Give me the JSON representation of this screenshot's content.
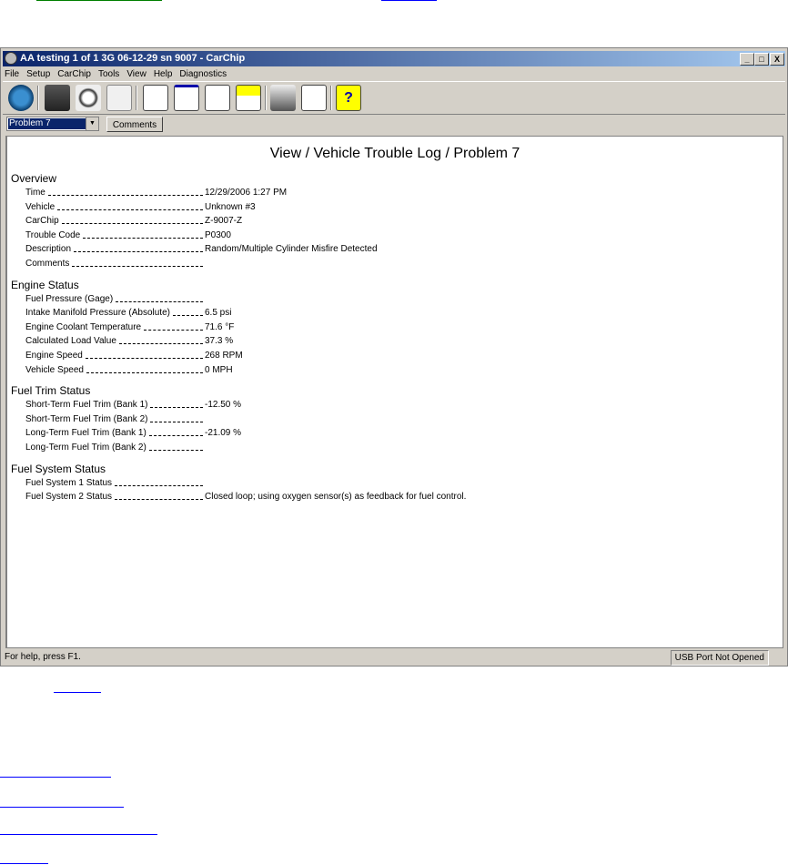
{
  "window": {
    "title": "AA testing 1 of 1 3G 06-12-29 sn 9007 - CarChip",
    "controls": [
      "_",
      "□",
      "X"
    ]
  },
  "menu": [
    "File",
    "Setup",
    "CarChip",
    "Tools",
    "View",
    "Help",
    "Diagnostics"
  ],
  "toolbar": [
    "home",
    "download",
    "inspect",
    "graph",
    "report",
    "calendar",
    "add-report",
    "warning-report",
    "print",
    "print-preview",
    "help"
  ],
  "problem_select": {
    "value": "Problem 7"
  },
  "comments_button": "Comments",
  "page_title": "View / Vehicle Trouble Log / Problem 7",
  "sections": [
    {
      "title": "Overview",
      "rows": [
        {
          "label": "Time",
          "value": "12/29/2006 1:27 PM"
        },
        {
          "label": "Vehicle",
          "value": "Unknown #3"
        },
        {
          "label": "CarChip",
          "value": "Z-9007-Z"
        },
        {
          "label": "Trouble Code",
          "value": "P0300"
        },
        {
          "label": "Description",
          "value": "Random/Multiple Cylinder Misfire Detected"
        },
        {
          "label": "Comments",
          "value": ""
        }
      ]
    },
    {
      "title": "Engine Status",
      "rows": [
        {
          "label": "Fuel Pressure (Gage)",
          "value": ""
        },
        {
          "label": "Intake Manifold Pressure (Absolute)",
          "value": "6.5 psi"
        },
        {
          "label": "Engine Coolant Temperature",
          "value": "71.6 °F"
        },
        {
          "label": "Calculated Load Value",
          "value": "37.3 %"
        },
        {
          "label": "Engine Speed",
          "value": "268 RPM"
        },
        {
          "label": "Vehicle Speed",
          "value": "0 MPH"
        }
      ]
    },
    {
      "title": "Fuel Trim Status",
      "rows": [
        {
          "label": "Short-Term Fuel Trim (Bank 1)",
          "value": "-12.50 %"
        },
        {
          "label": "Short-Term Fuel Trim (Bank 2)",
          "value": ""
        },
        {
          "label": "Long-Term Fuel Trim (Bank 1)",
          "value": "-21.09 %"
        },
        {
          "label": "Long-Term Fuel Trim (Bank 2)",
          "value": ""
        }
      ]
    },
    {
      "title": "Fuel System Status",
      "rows": [
        {
          "label": "Fuel System 1 Status",
          "value": ""
        },
        {
          "label": "Fuel System 2 Status",
          "value": "Closed loop; using oxygen sensor(s) as feedback for fuel control."
        }
      ]
    }
  ],
  "statusbar": {
    "help": "For help, press F1.",
    "port": "USB Port Not Opened"
  },
  "colors": {
    "link_green": "#008000",
    "link_blue": "#0000ff",
    "title_start": "#0a246a",
    "title_end": "#a6caf0"
  }
}
